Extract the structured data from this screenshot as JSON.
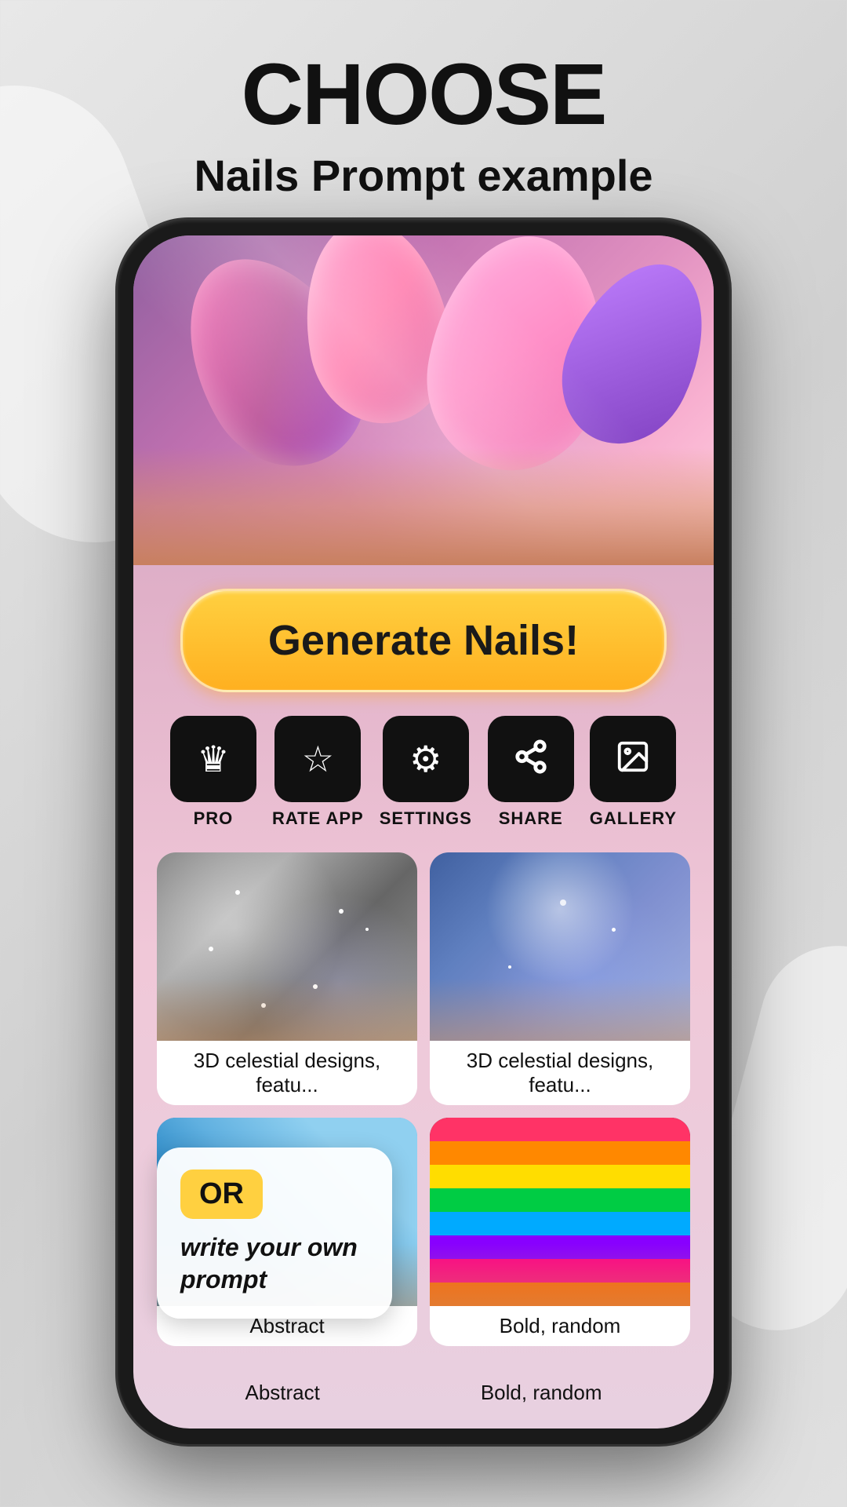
{
  "page": {
    "title": "CHOOSE",
    "subtitle": "Nails Prompt example"
  },
  "generate_button": {
    "label": "Generate Nails!"
  },
  "toolbar": {
    "items": [
      {
        "id": "pro",
        "icon": "crown",
        "label": "PRO"
      },
      {
        "id": "rate-app",
        "icon": "star",
        "label": "RATE APP"
      },
      {
        "id": "settings",
        "icon": "gear",
        "label": "SETTINGS"
      },
      {
        "id": "share",
        "icon": "share",
        "label": "SHARE"
      },
      {
        "id": "gallery",
        "icon": "gallery",
        "label": "GALLERY"
      }
    ]
  },
  "gallery": {
    "items": [
      {
        "id": 1,
        "label": "3D celestial designs, featu...",
        "style": "silver-glitter"
      },
      {
        "id": 2,
        "label": "3D celestial designs, featu...",
        "style": "blue-chrome"
      },
      {
        "id": 3,
        "label": "Abstract",
        "style": "blue-matte"
      },
      {
        "id": 4,
        "label": "Bold, random",
        "style": "colorful-stripes"
      }
    ]
  },
  "or_prompt": {
    "badge": "OR",
    "text": "write your own prompt"
  },
  "bottom_labels": {
    "left": "Abstract",
    "right": "Bold, random"
  },
  "colors": {
    "button_bg": "#ffd040",
    "button_text": "#1a1a1a",
    "toolbar_bg": "#111111",
    "page_bg": "#e0e0e0"
  }
}
